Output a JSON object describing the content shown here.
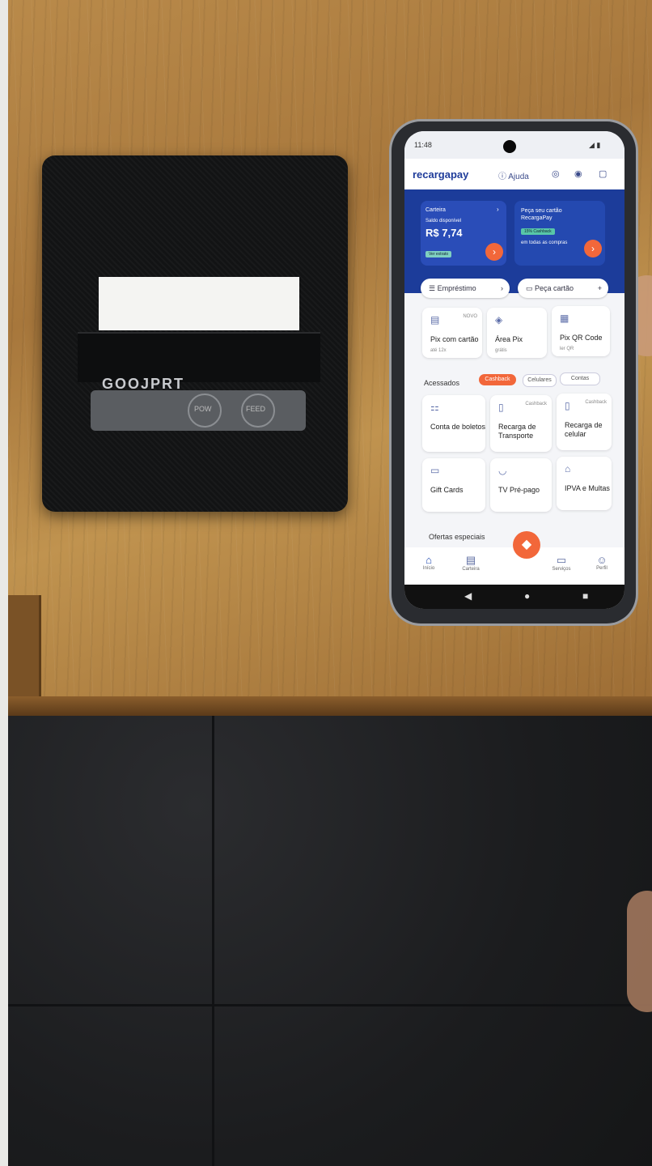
{
  "printer": {
    "label": "GOOJPRT",
    "btn_left": "POW",
    "btn_right": "FEED"
  },
  "phone": {
    "status": {
      "time": "11:48",
      "icons": "◢ ▮"
    },
    "header": {
      "logo": "recargapay",
      "help": "Ajuda"
    },
    "wallet_card": {
      "title": "Carteira",
      "balance_label": "Saldo disponível",
      "balance_value": "R$ 7,74",
      "tag": "Ver extrato"
    },
    "promo_card": {
      "title": "Peça seu cartão RecargaPay",
      "tag": "15% Cashback",
      "subtitle": "em todas as compras"
    },
    "pill_left": "Empréstimo",
    "pill_right": "Peça cartão",
    "tiles_row1": [
      {
        "title": "Pix com cartão",
        "sub": "até 12x",
        "badge": "NOVO"
      },
      {
        "title": "Área Pix",
        "sub": "grátis",
        "badge": ""
      },
      {
        "title": "Pix QR Code",
        "sub": "ler QR",
        "badge": ""
      }
    ],
    "section": {
      "label": "Acessados",
      "chips": [
        "Cashback",
        "Celulares",
        "Contas"
      ]
    },
    "tiles_row2": [
      {
        "title": "Conta de boletos",
        "sub": "",
        "badge": ""
      },
      {
        "title": "Recarga de Transporte",
        "sub": "",
        "badge": "Cashback"
      },
      {
        "title": "Recarga de celular",
        "sub": "",
        "badge": "Cashback"
      }
    ],
    "tiles_row3": [
      {
        "title": "Gift Cards",
        "sub": "",
        "badge": ""
      },
      {
        "title": "TV Pré-pago",
        "sub": "",
        "badge": ""
      },
      {
        "title": "IPVA e Multas",
        "sub": "",
        "badge": ""
      }
    ],
    "offers_label": "Ofertas especiais",
    "nav": [
      "Início",
      "Carteira",
      "",
      "Serviços",
      "Perfil"
    ]
  }
}
